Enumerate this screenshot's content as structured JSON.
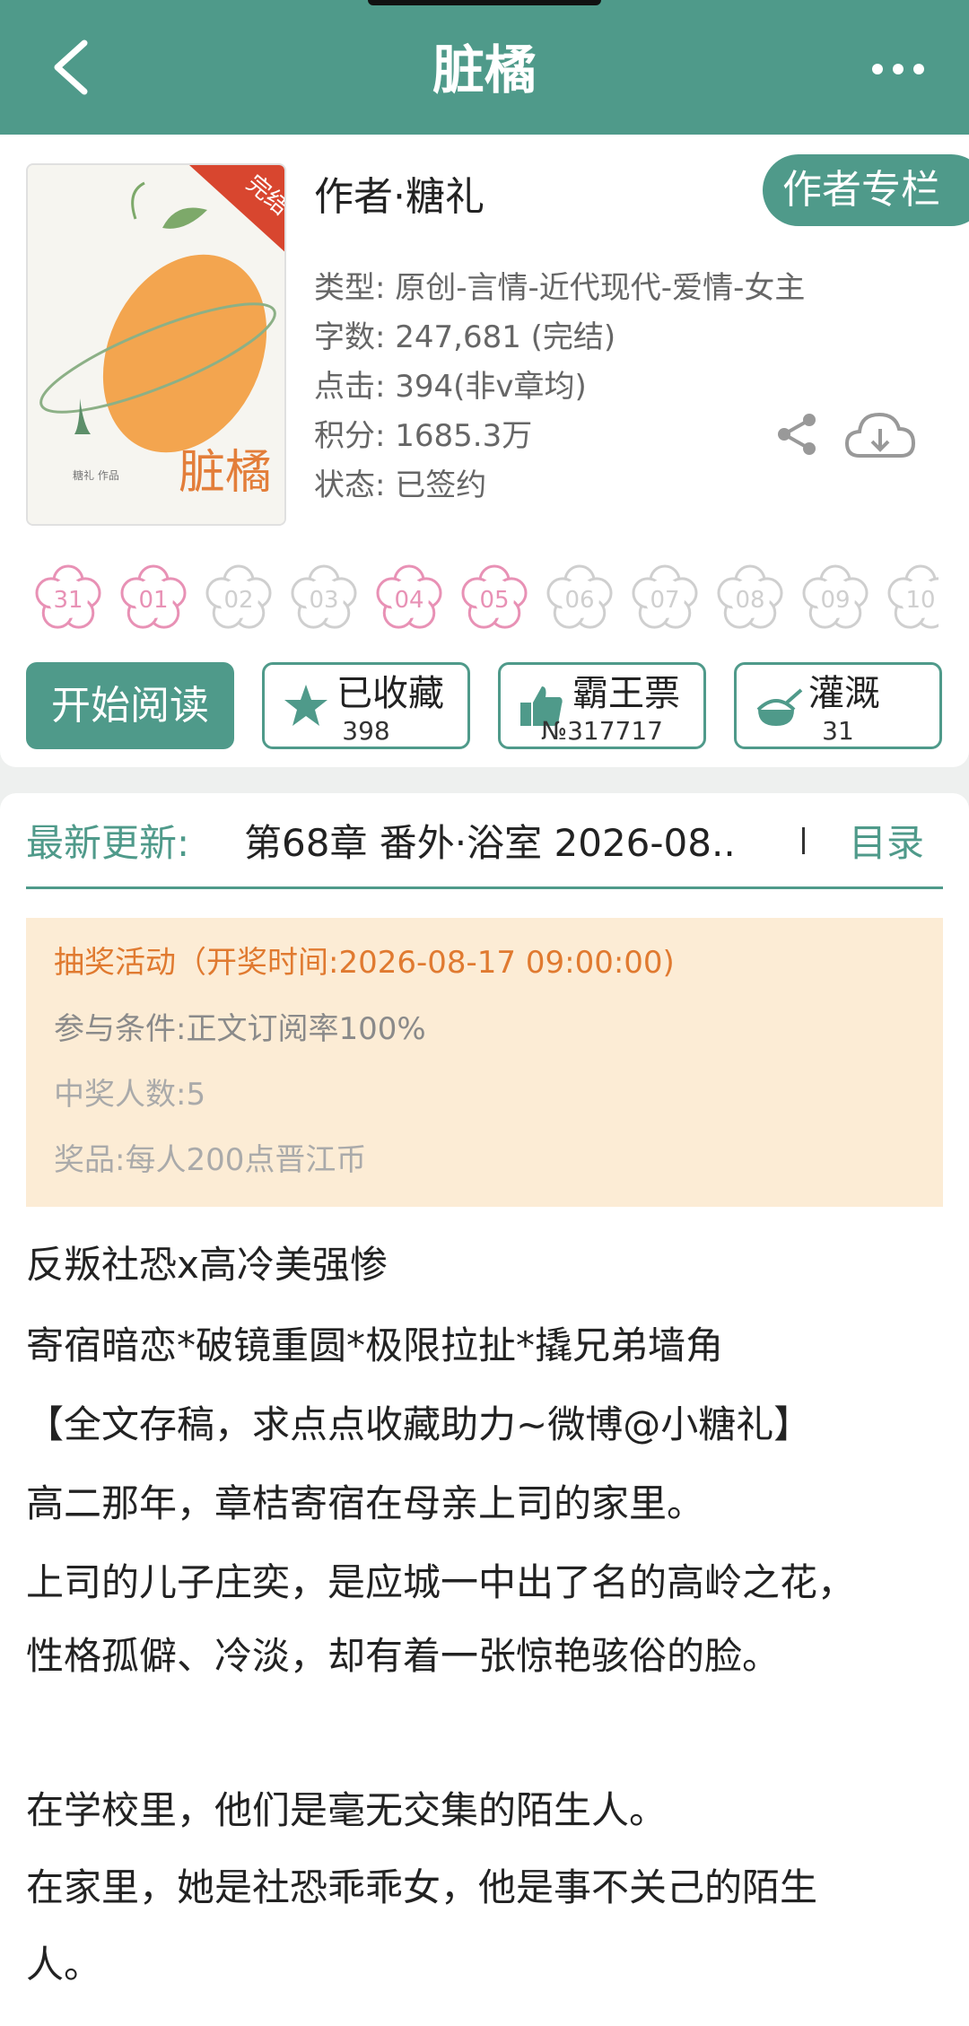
{
  "header": {
    "title": "脏橘"
  },
  "book": {
    "author": "作者·糖礼",
    "author_column": "作者专栏",
    "type": "类型: 原创-言情-近代现代-爱情-女主",
    "words": "字数: 247,681 (完结)",
    "clicks": "点击: 394(非v章均)",
    "score": "积分: 1685.3万",
    "status": "状态: 已签约",
    "cover": {
      "badge": "完结",
      "title": "脏橘",
      "subtitle": "糖礼 作品"
    }
  },
  "flowers": [
    {
      "label": "31",
      "active": true
    },
    {
      "label": "01",
      "active": true
    },
    {
      "label": "02",
      "active": false
    },
    {
      "label": "03",
      "active": false
    },
    {
      "label": "04",
      "active": true
    },
    {
      "label": "05",
      "active": true
    },
    {
      "label": "06",
      "active": false
    },
    {
      "label": "07",
      "active": false
    },
    {
      "label": "08",
      "active": false
    },
    {
      "label": "09",
      "active": false
    },
    {
      "label": "10",
      "active": false
    }
  ],
  "actions": {
    "read": "开始阅读",
    "collect": {
      "label": "已收藏",
      "count": "398"
    },
    "bawang": {
      "label": "霸王票",
      "count": "№317717"
    },
    "water": {
      "label": "灌溉",
      "count": "31"
    }
  },
  "update": {
    "label": "最新更新:",
    "text": "第68章  番外·浴室  2026-08..",
    "toc": "目录"
  },
  "lottery": {
    "title": "抽奖活动（开奖时间:2026-08-17 09:00:00)",
    "condition": "参与条件:正文订阅率100%",
    "winners": "中奖人数:5",
    "prize": "奖品:每人200点晋江币"
  },
  "description": [
    "反叛社恐x高冷美强惨",
    "寄宿暗恋*破镜重圆*极限拉扯*撬兄弟墙角",
    "【全文存稿，求点点收藏助力~微博@小糖礼】",
    "高二那年，章桔寄宿在母亲上司的家里。",
    "上司的儿子庄奕，是应城一中出了名的高岭之花，",
    "性格孤僻、冷淡，却有着一张惊艳骇俗的脸。",
    "",
    "在学校里，他们是毫无交集的陌生人。",
    "在家里，她是社恐乖乖女，他是事不关己的陌生",
    "人。"
  ],
  "colors": {
    "accent": "#4f9a8a",
    "flower_active": "#e891b5",
    "flower_inactive": "#cfcfcf",
    "lottery_bg": "#fcecd5",
    "lottery_title": "#e07a30"
  }
}
